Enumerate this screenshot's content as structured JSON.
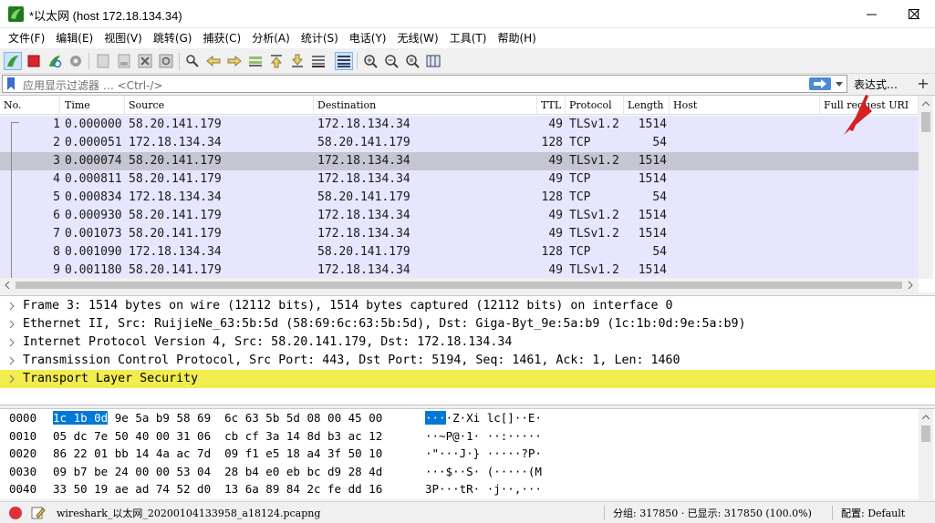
{
  "window": {
    "title": "*以太网 (host 172.18.134.34)",
    "minimize_icon": "minimize-icon",
    "maximize_icon": "maximize-icon",
    "close_icon": "close-icon"
  },
  "menu": [
    "文件(F)",
    "编辑(E)",
    "视图(V)",
    "跳转(G)",
    "捕获(C)",
    "分析(A)",
    "统计(S)",
    "电话(Y)",
    "无线(W)",
    "工具(T)",
    "帮助(H)"
  ],
  "toolbar": {
    "icons": [
      "start-capture-icon",
      "stop-capture-icon",
      "restart-capture-icon",
      "capture-options-icon",
      "open-file-icon",
      "save-file-icon",
      "close-file-icon",
      "reload-icon",
      "find-packet-icon",
      "go-back-icon",
      "go-forward-icon",
      "go-to-packet-icon",
      "go-first-icon",
      "go-last-icon",
      "auto-scroll-icon",
      "colorize-icon",
      "zoom-in-icon",
      "zoom-out-icon",
      "zoom-normal-icon",
      "resize-columns-icon"
    ]
  },
  "filter": {
    "placeholder": "应用显示过滤器 … <Ctrl-/>",
    "expression_label": "表达式…",
    "plus_label": "+"
  },
  "packet_list": {
    "columns": [
      "No.",
      "Time",
      "Source",
      "Destination",
      "TTL",
      "Protocol",
      "Length",
      "Host",
      "Full request URI"
    ],
    "rows": [
      {
        "no": "1",
        "time": "0.000000",
        "src": "58.20.141.179",
        "dst": "172.18.134.34",
        "ttl": "49",
        "proto": "TLSv1.2",
        "len": "1514"
      },
      {
        "no": "2",
        "time": "0.000051",
        "src": "172.18.134.34",
        "dst": "58.20.141.179",
        "ttl": "128",
        "proto": "TCP",
        "len": "54"
      },
      {
        "no": "3",
        "time": "0.000074",
        "src": "58.20.141.179",
        "dst": "172.18.134.34",
        "ttl": "49",
        "proto": "TLSv1.2",
        "len": "1514"
      },
      {
        "no": "4",
        "time": "0.000811",
        "src": "58.20.141.179",
        "dst": "172.18.134.34",
        "ttl": "49",
        "proto": "TCP",
        "len": "1514"
      },
      {
        "no": "5",
        "time": "0.000834",
        "src": "172.18.134.34",
        "dst": "58.20.141.179",
        "ttl": "128",
        "proto": "TCP",
        "len": "54"
      },
      {
        "no": "6",
        "time": "0.000930",
        "src": "58.20.141.179",
        "dst": "172.18.134.34",
        "ttl": "49",
        "proto": "TLSv1.2",
        "len": "1514"
      },
      {
        "no": "7",
        "time": "0.001073",
        "src": "58.20.141.179",
        "dst": "172.18.134.34",
        "ttl": "49",
        "proto": "TLSv1.2",
        "len": "1514"
      },
      {
        "no": "8",
        "time": "0.001090",
        "src": "172.18.134.34",
        "dst": "58.20.141.179",
        "ttl": "128",
        "proto": "TCP",
        "len": "54"
      },
      {
        "no": "9",
        "time": "0.001180",
        "src": "58.20.141.179",
        "dst": "172.18.134.34",
        "ttl": "49",
        "proto": "TLSv1.2",
        "len": "1514"
      }
    ]
  },
  "details": [
    "Frame 3: 1514 bytes on wire (12112 bits), 1514 bytes captured (12112 bits) on interface 0",
    "Ethernet II, Src: RuijieNe_63:5b:5d (58:69:6c:63:5b:5d), Dst: Giga-Byt_9e:5a:b9 (1c:1b:0d:9e:5a:b9)",
    "Internet Protocol Version 4, Src: 58.20.141.179, Dst: 172.18.134.34",
    "Transmission Control Protocol, Src Port: 443, Dst Port: 5194, Seq: 1461, Ack: 1, Len: 1460",
    "Transport Layer Security"
  ],
  "bytes": [
    {
      "off": "0000",
      "hl": "1c 1b 0d",
      "rest": " 9e 5a b9 58 69  6c 63 5b 5d 08 00 45 00",
      "ascii_hl": "···",
      "ascii_rest": "·Z·Xi lc[]··E·"
    },
    {
      "off": "0010",
      "hl": "",
      "rest": "05 dc 7e 50 40 00 31 06  cb cf 3a 14 8d b3 ac 12",
      "ascii_hl": "",
      "ascii_rest": "··~P@·1· ··:·····"
    },
    {
      "off": "0020",
      "hl": "",
      "rest": "86 22 01 bb 14 4a ac 7d  09 f1 e5 18 a4 3f 50 10",
      "ascii_hl": "",
      "ascii_rest": "·\"···J·} ·····?P·"
    },
    {
      "off": "0030",
      "hl": "",
      "rest": "09 b7 be 24 00 00 53 04  28 b4 e0 eb bc d9 28 4d",
      "ascii_hl": "",
      "ascii_rest": "···$··S· (·····(M"
    },
    {
      "off": "0040",
      "hl": "",
      "rest": "33 50 19 ae ad 74 52 d0  13 6a 89 84 2c fe dd 16",
      "ascii_hl": "",
      "ascii_rest": "3P···tR· ·j··,···"
    }
  ],
  "status": {
    "file": "wireshark_以太网_20200104133958_a18124.pcapng",
    "packets": "分组: 317850 · 已显示: 317850 (100.0%)",
    "profile": "配置: Default"
  },
  "colors": {
    "row_bg": "#e7e6ff",
    "row_selected": "#c6c5d2",
    "detail_selected": "#f2ec4f",
    "hex_highlight": "#0078d7"
  }
}
